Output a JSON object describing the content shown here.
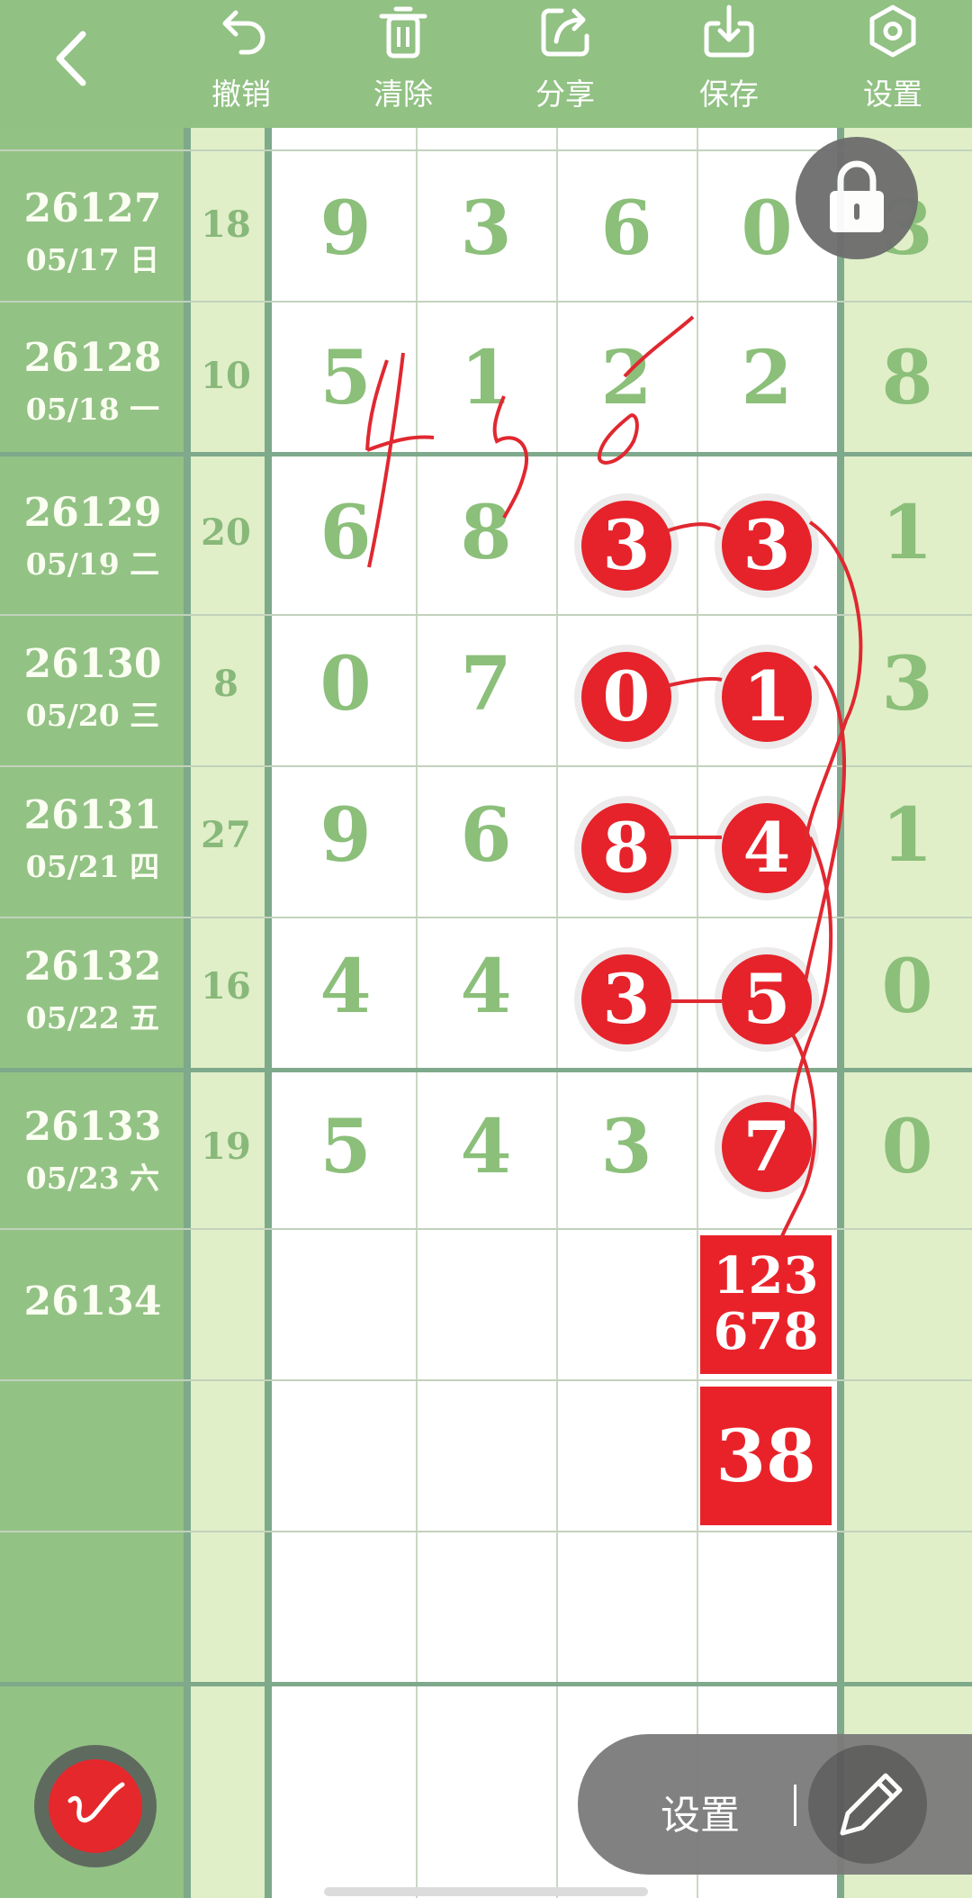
{
  "toolbar": {
    "buttons": [
      {
        "label": "撤销",
        "icon": "undo-icon"
      },
      {
        "label": "清除",
        "icon": "trash-icon"
      },
      {
        "label": "分享",
        "icon": "share-icon"
      },
      {
        "label": "保存",
        "icon": "download-icon"
      },
      {
        "label": "设置",
        "icon": "gear-icon"
      }
    ]
  },
  "rows": [
    {
      "period": "26127",
      "date": "05/17 日",
      "sum": "18",
      "digits": [
        "9",
        "3",
        "6",
        "0"
      ],
      "right": "3"
    },
    {
      "period": "26128",
      "date": "05/18 一",
      "sum": "10",
      "digits": [
        "5",
        "1",
        "2",
        "2"
      ],
      "right": "8"
    },
    {
      "period": "26129",
      "date": "05/19 二",
      "sum": "20",
      "digits": [
        "6",
        "8",
        "3",
        "3"
      ],
      "right": "1"
    },
    {
      "period": "26130",
      "date": "05/20 三",
      "sum": "8",
      "digits": [
        "0",
        "7",
        "0",
        "1"
      ],
      "right": "3"
    },
    {
      "period": "26131",
      "date": "05/21 四",
      "sum": "27",
      "digits": [
        "9",
        "6",
        "8",
        "4"
      ],
      "right": "1"
    },
    {
      "period": "26132",
      "date": "05/22 五",
      "sum": "16",
      "digits": [
        "4",
        "4",
        "3",
        "5"
      ],
      "right": "0"
    },
    {
      "period": "26133",
      "date": "05/23 六",
      "sum": "19",
      "digits": [
        "5",
        "4",
        "3",
        "7"
      ],
      "right": "0"
    }
  ],
  "next_period": "26134",
  "prediction": {
    "box1_line1": "123",
    "box1_line2": "678",
    "box2": "38"
  },
  "handwriting": "4 5 0",
  "floating": {
    "settings_label": "设置",
    "lock_icon": "lock-icon",
    "pen_icon": "pen-icon",
    "edit_icon": "pencil-icon"
  },
  "colors": {
    "toolbar": "#91c183",
    "period_col": "#93c285",
    "light_col": "#e0efc8",
    "digit": "#8bbf7a",
    "mark_red": "#e6222a"
  }
}
